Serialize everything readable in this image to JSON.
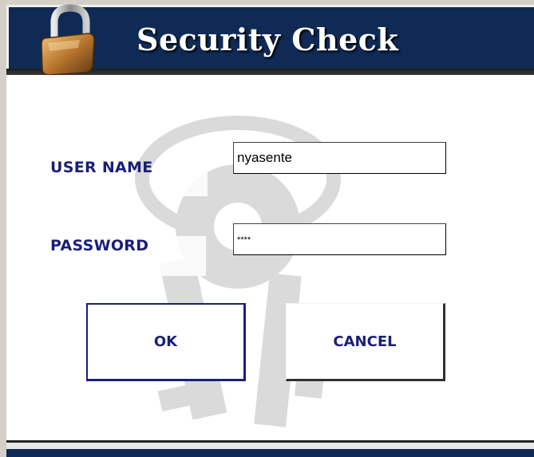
{
  "window": {
    "title": "Security Check"
  },
  "form": {
    "username_label": "USER NAME",
    "username_value": "nyasente",
    "password_label": "PASSWORD",
    "password_value": "****"
  },
  "buttons": {
    "ok_label": "OK",
    "cancel_label": "CANCEL"
  },
  "icons": {
    "title_icon": "padlock-icon",
    "background": "keys-icon"
  },
  "colors": {
    "title_bar": "#0f2a55",
    "label_text": "#1a1f7a",
    "content_bg": "#ffffff"
  }
}
